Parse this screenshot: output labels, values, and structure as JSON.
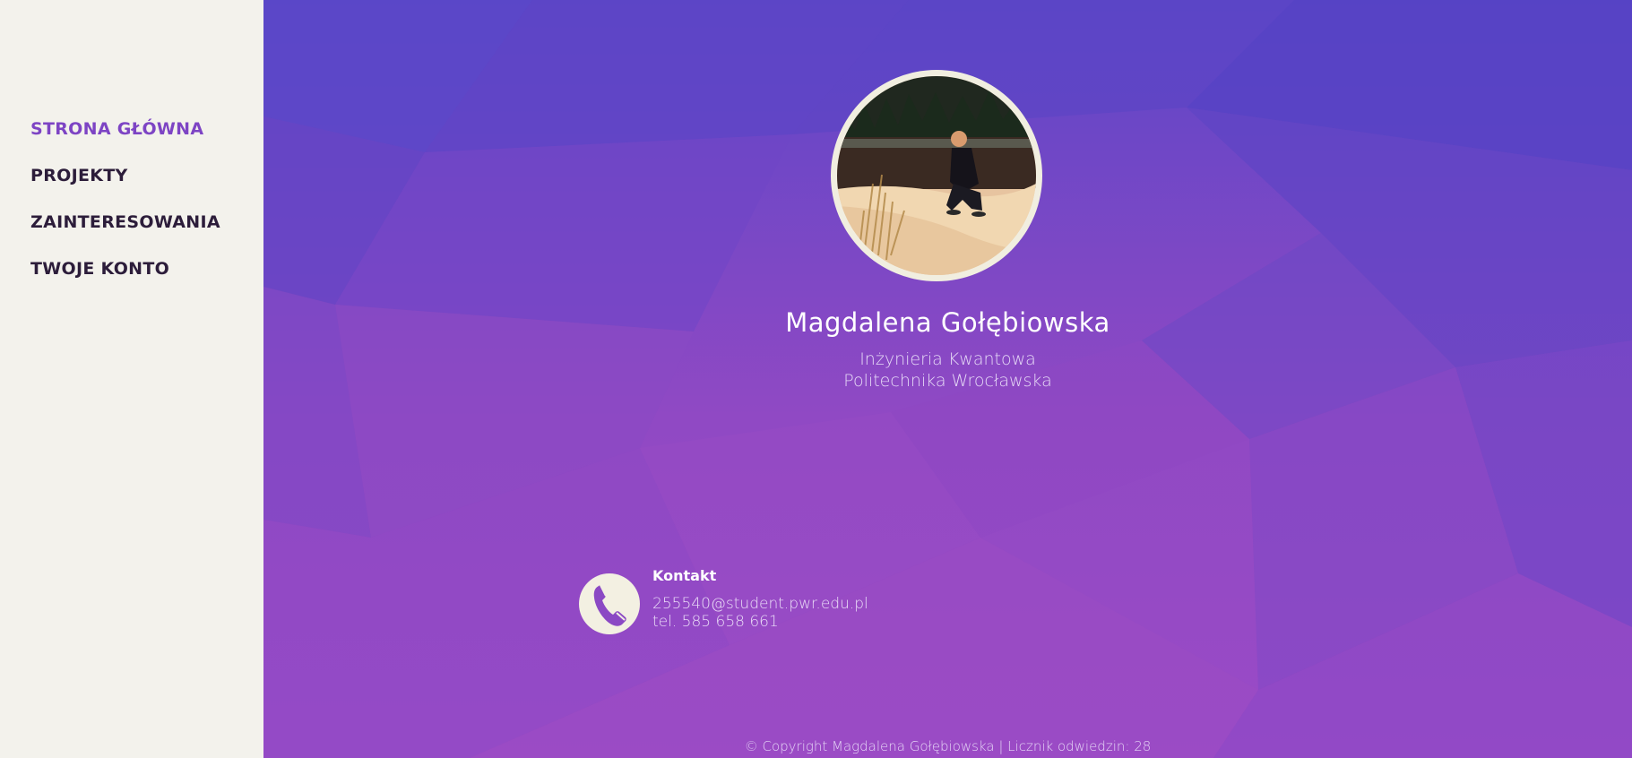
{
  "nav": {
    "items": [
      {
        "label": "STRONA GŁÓWNA",
        "active": true
      },
      {
        "label": "PROJEKTY",
        "active": false
      },
      {
        "label": "ZAINTERESOWANIA",
        "active": false
      },
      {
        "label": "TWOJE KONTO",
        "active": false
      }
    ]
  },
  "profile": {
    "name": "Magdalena Gołębiowska",
    "subtitle1": "Inżynieria Kwantowa",
    "subtitle2": "Politechnika Wrocławska",
    "photo_icon": "profile-photo"
  },
  "contact": {
    "icon": "phone-icon",
    "title": "Kontakt",
    "email": "255540@student.pwr.edu.pl",
    "phone": "tel. 585 658 661"
  },
  "footer": {
    "text": "© Copyright Magdalena Gołębiowska | Licznik odwiedzin: 28"
  },
  "colors": {
    "sidebar_bg": "#f3f2ec",
    "accent": "#7d44c4",
    "nav_text": "#2c1d3a",
    "main_bg_top": "#5b46c6",
    "main_bg_mid": "#9b4cc4",
    "avatar_ring": "#f1eee0"
  }
}
